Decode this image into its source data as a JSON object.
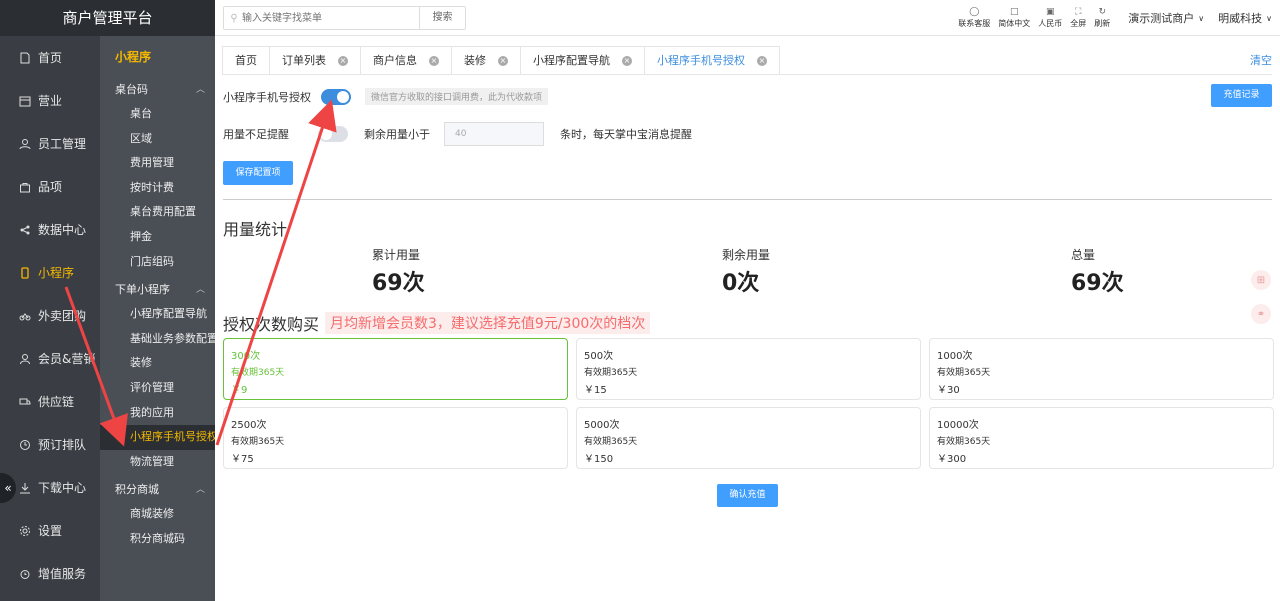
{
  "app": {
    "title": "商户管理平台"
  },
  "nav": {
    "items": [
      {
        "label": "首页",
        "icon": "document-icon"
      },
      {
        "label": "营业",
        "icon": "calendar-icon"
      },
      {
        "label": "员工管理",
        "icon": "users-icon"
      },
      {
        "label": "品项",
        "icon": "bag-icon"
      },
      {
        "label": "数据中心",
        "icon": "share-icon"
      },
      {
        "label": "小程序",
        "icon": "phone-icon",
        "active": true
      },
      {
        "label": "外卖团购",
        "icon": "bike-icon"
      },
      {
        "label": "会员&营销",
        "icon": "user-icon"
      },
      {
        "label": "供应链",
        "icon": "truck-icon"
      },
      {
        "label": "预订排队",
        "icon": "clock-icon"
      },
      {
        "label": "下载中心",
        "icon": "download-icon"
      },
      {
        "label": "设置",
        "icon": "gear-icon"
      },
      {
        "label": "增值服务",
        "icon": "alarm-icon"
      }
    ]
  },
  "submenu": {
    "title": "小程序",
    "groups": [
      {
        "label": "桌台码",
        "items": [
          "桌台",
          "区域",
          "费用管理",
          "按时计费",
          "桌台费用配置",
          "押金",
          "门店组码"
        ]
      },
      {
        "label": "下单小程序",
        "items": [
          "小程序配置导航",
          "基础业务参数配置",
          "装修",
          "评价管理",
          "我的应用",
          "小程序手机号授权",
          "物流管理"
        ]
      },
      {
        "label": "积分商城",
        "items": [
          "商城装修",
          "积分商城码"
        ]
      }
    ]
  },
  "topbar": {
    "search_placeholder": "输入关键字找菜单",
    "search_button": "搜索",
    "tools": [
      {
        "label": "联系客服",
        "icon": "headset-icon"
      },
      {
        "label": "简体中文",
        "icon": "language-icon"
      },
      {
        "label": "人民币",
        "icon": "currency-icon"
      },
      {
        "label": "全屏",
        "icon": "fullscreen-icon"
      },
      {
        "label": "刷新",
        "icon": "refresh-icon"
      }
    ],
    "merchant": "演示测试商户",
    "org": "明威科技"
  },
  "tabs": {
    "items": [
      "首页",
      "订单列表",
      "商户信息",
      "装修",
      "小程序配置导航",
      "小程序手机号授权"
    ],
    "clear_label": "清空"
  },
  "settings": {
    "auth_label": "小程序手机号授权",
    "auth_enabled": true,
    "auth_hint": "微信官方收取的接口调用费，此为代收款项",
    "recharge_record_button": "充值记录",
    "low_usage_label": "用量不足提醒",
    "low_usage_enabled": false,
    "remaining_prefix": "剩余用量小于",
    "remaining_value": "40",
    "remaining_suffix": "条时，每天掌中宝消息提醒",
    "save_button": "保存配置项"
  },
  "usage": {
    "title": "用量统计",
    "stats": [
      {
        "label": "累计用量",
        "value": "69次"
      },
      {
        "label": "剩余用量",
        "value": "0次"
      },
      {
        "label": "总量",
        "value": "69次"
      }
    ]
  },
  "purchase": {
    "title": "授权次数购买",
    "tip": "月均新增会员数3，建议选择充值9元/300次的档次",
    "packages": [
      {
        "name": "300次",
        "validity": "有效期365天",
        "price": "￥9",
        "selected": true
      },
      {
        "name": "500次",
        "validity": "有效期365天",
        "price": "￥15"
      },
      {
        "name": "1000次",
        "validity": "有效期365天",
        "price": "￥30"
      },
      {
        "name": "2500次",
        "validity": "有效期365天",
        "price": "￥75"
      },
      {
        "name": "5000次",
        "validity": "有效期365天",
        "price": "￥150"
      },
      {
        "name": "10000次",
        "validity": "有效期365天",
        "price": "￥300"
      }
    ],
    "confirm_button": "确认充值"
  },
  "colors": {
    "accent": "#409eff",
    "active_menu": "#f5b800",
    "selected_pkg": "#67c23a",
    "tip": "#f56c6c",
    "annotation_arrow": "#ee4444"
  }
}
